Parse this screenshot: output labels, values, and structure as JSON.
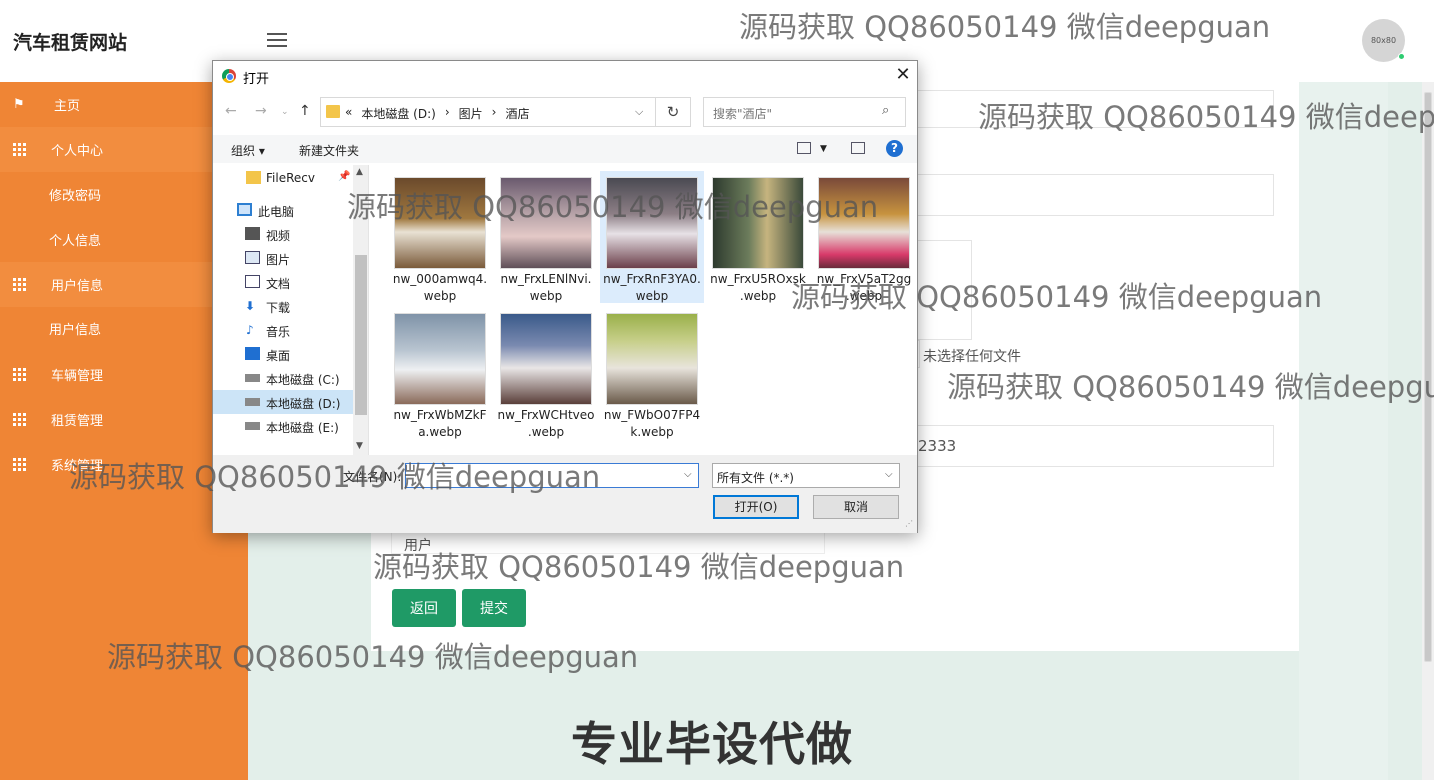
{
  "app": {
    "title": "汽车租赁网站",
    "avatar_text": "80x80"
  },
  "sidebar": {
    "items": [
      {
        "label": "主页"
      },
      {
        "label": "个人中心"
      },
      {
        "label": "修改密码"
      },
      {
        "label": "个人信息"
      },
      {
        "label": "用户信息"
      },
      {
        "label": "用户信息"
      },
      {
        "label": "车辆管理"
      },
      {
        "label": "租赁管理"
      },
      {
        "label": "系统管理"
      }
    ]
  },
  "form": {
    "file_hint": "未选择任何文件",
    "phone_value": "2333",
    "role_label": "用户",
    "back_button": "返回",
    "submit_button": "提交"
  },
  "slogan": "专业毕设代做",
  "watermark": "源码获取 QQ86050149 微信deepguan",
  "dialog": {
    "title": "打开",
    "breadcrumbs": [
      "本地磁盘 (D:)",
      "图片",
      "酒店"
    ],
    "breadcrumb_prefix": "«",
    "search_placeholder": "搜索\"酒店\"",
    "toolbar": {
      "organize": "组织",
      "new_folder": "新建文件夹",
      "help": "?"
    },
    "tree": [
      {
        "label": "FileRecv",
        "icon": "folder-icon"
      },
      {
        "label": "此电脑",
        "icon": "computer-icon"
      },
      {
        "label": "视频",
        "icon": "video-icon"
      },
      {
        "label": "图片",
        "icon": "picture-icon"
      },
      {
        "label": "文档",
        "icon": "document-icon"
      },
      {
        "label": "下载",
        "icon": "download-icon"
      },
      {
        "label": "音乐",
        "icon": "music-icon"
      },
      {
        "label": "桌面",
        "icon": "desktop-icon"
      },
      {
        "label": "本地磁盘 (C:)",
        "icon": "drive-icon"
      },
      {
        "label": "本地磁盘 (D:)",
        "icon": "drive-icon"
      },
      {
        "label": "本地磁盘 (E:)",
        "icon": "drive-icon"
      }
    ],
    "files": [
      {
        "line1": "nw_000amwq4.",
        "line2": "webp"
      },
      {
        "line1": "nw_FrxLENlNvi.",
        "line2": "webp"
      },
      {
        "line1": "nw_FrxRnF3YA0.",
        "line2": "webp"
      },
      {
        "line1": "nw_FrxU5ROxsk",
        "line2": ".webp"
      },
      {
        "line1": "nw_FrxV5aT2gg",
        "line2": ".webp"
      },
      {
        "line1": "nw_FrxWbMZkF",
        "line2": "a.webp"
      },
      {
        "line1": "nw_FrxWCHtveo",
        "line2": ".webp"
      },
      {
        "line1": "nw_FWbO07FP4",
        "line2": "k.webp"
      }
    ],
    "filename_label": "文件名(N):",
    "filename_value": "",
    "filetype": "所有文件 (*.*)",
    "open_button": "打开(O)",
    "cancel_button": "取消"
  }
}
